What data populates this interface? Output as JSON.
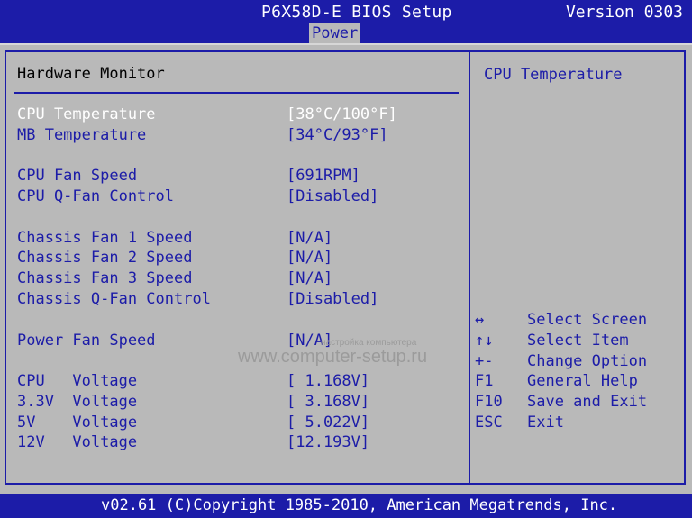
{
  "header": {
    "title": "P6X58D-E BIOS Setup",
    "version": "Version 0303",
    "active_tab": "Power"
  },
  "main": {
    "section_title": "Hardware Monitor",
    "items": [
      {
        "label": "CPU Temperature",
        "value": "[38°C/100°F]",
        "selected": true
      },
      {
        "label": "MB Temperature",
        "value": "[34°C/93°F]"
      },
      {
        "label": "CPU Fan Speed",
        "value": "[691RPM]"
      },
      {
        "label": "CPU Q-Fan Control",
        "value": "[Disabled]"
      },
      {
        "label": "Chassis Fan 1 Speed",
        "value": "[N/A]"
      },
      {
        "label": "Chassis Fan 2 Speed",
        "value": "[N/A]"
      },
      {
        "label": "Chassis Fan 3 Speed",
        "value": "[N/A]"
      },
      {
        "label": "Chassis Q-Fan Control",
        "value": "[Disabled]"
      },
      {
        "label": "Power Fan Speed",
        "value": "[N/A]"
      },
      {
        "label": "CPU   Voltage",
        "value": "[ 1.168V]"
      },
      {
        "label": "3.3V  Voltage",
        "value": "[ 3.168V]"
      },
      {
        "label": "5V    Voltage",
        "value": "[ 5.022V]"
      },
      {
        "label": "12V   Voltage",
        "value": "[12.193V]"
      }
    ]
  },
  "help": {
    "title": "CPU Temperature",
    "keys": [
      {
        "key": "↔",
        "desc": "Select Screen"
      },
      {
        "key": "↑↓",
        "desc": "Select Item"
      },
      {
        "key": "+-",
        "desc": "Change Option"
      },
      {
        "key": "F1",
        "desc": "General Help"
      },
      {
        "key": "F10",
        "desc": "Save and Exit"
      },
      {
        "key": "ESC",
        "desc": "Exit"
      }
    ]
  },
  "watermark": {
    "small": "настройка компьютера",
    "big": "www.computer-setup.ru"
  },
  "footer": {
    "copyright": "v02.61 (C)Copyright 1985-2010, American Megatrends, Inc."
  },
  "colors": {
    "bios_blue": "#1c1ca8",
    "panel_gray": "#b9b9b9",
    "highlight": "#ffffff"
  }
}
